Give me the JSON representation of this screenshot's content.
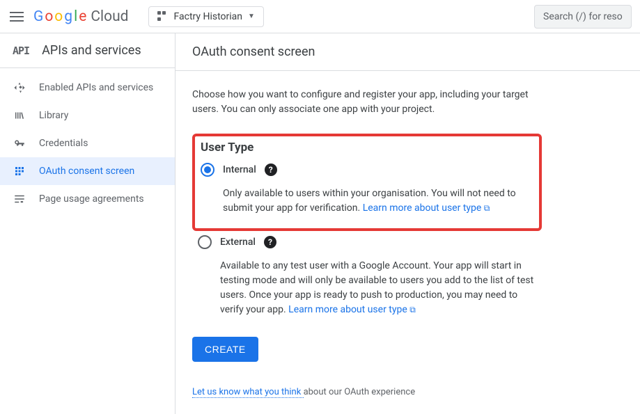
{
  "header": {
    "logo_cloud": "Cloud",
    "project_name": "Factry Historian",
    "search_placeholder": "Search (/) for reso"
  },
  "sidebar": {
    "header_icon": "API",
    "header_title": "APIs and services",
    "items": [
      {
        "label": "Enabled APIs and services",
        "active": false
      },
      {
        "label": "Library",
        "active": false
      },
      {
        "label": "Credentials",
        "active": false
      },
      {
        "label": "OAuth consent screen",
        "active": true
      },
      {
        "label": "Page usage agreements",
        "active": false
      }
    ]
  },
  "content": {
    "title": "OAuth consent screen",
    "intro": "Choose how you want to configure and register your app, including your target users. You can only associate one app with your project.",
    "section_title": "User Type",
    "internal": {
      "label": "Internal",
      "desc": "Only available to users within your organisation. You will not need to submit your app for verification. ",
      "link": "Learn more about user type"
    },
    "external": {
      "label": "External",
      "desc": "Available to any test user with a Google Account. Your app will start in testing mode and will only be available to users you add to the list of test users. Once your app is ready to push to production, you may need to verify your app. ",
      "link": "Learn more about user type"
    },
    "create_button": "CREATE",
    "feedback_link": "Let us know what you think ",
    "feedback_text": "about our OAuth experience"
  }
}
